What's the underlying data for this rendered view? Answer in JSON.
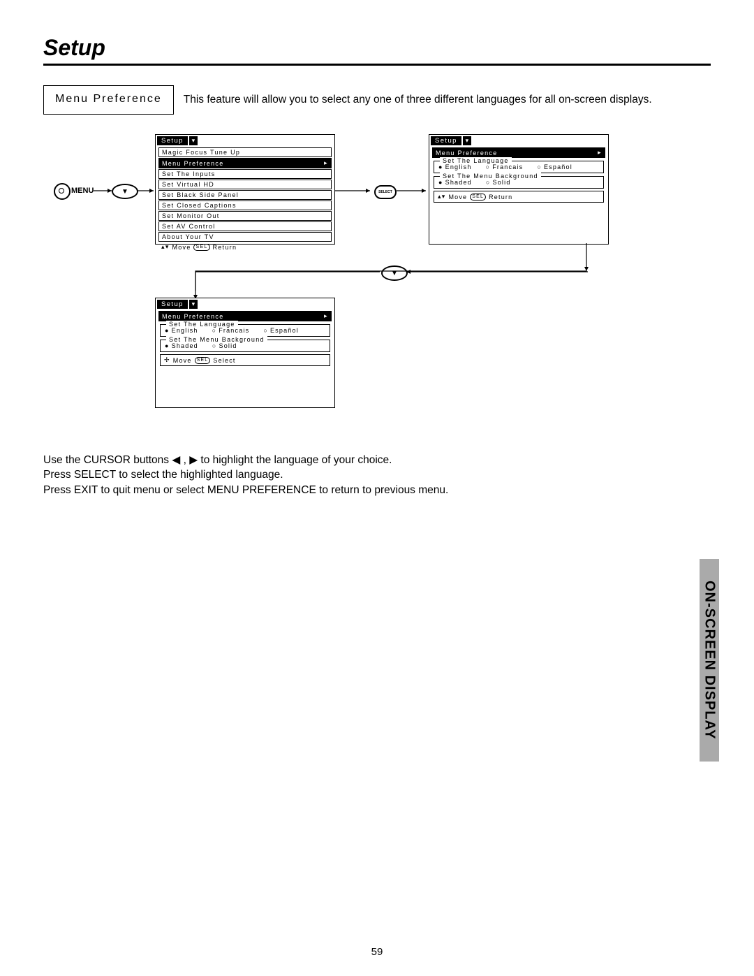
{
  "page_title": "Setup",
  "feature_name": "Menu Preference",
  "feature_desc": "This feature will allow you to select any one of three different languages for all on-screen displays.",
  "remote_label": "MENU",
  "select_btn_label": "SELECT",
  "osd1": {
    "title": "Setup",
    "items": [
      "Magic Focus Tune Up",
      "Menu Preference",
      "Set The Inputs",
      "Set Virtual HD",
      "Set Black Side Panel",
      "Set Closed Captions",
      "Set Monitor Out",
      "Set AV Control",
      "About Your TV"
    ],
    "highlight_index": 1,
    "footer_move": "Move",
    "footer_sel": "SEL",
    "footer_return": "Return"
  },
  "osd_lang": {
    "title": "Setup",
    "sub": "Menu Preference",
    "group1_title": "Set The Language",
    "lang_options": [
      {
        "label": "English",
        "dot": "●"
      },
      {
        "label": "Francais",
        "dot": "○"
      },
      {
        "label": "Español",
        "dot": "○"
      }
    ],
    "group2_title": "Set The Menu Background",
    "bg_options": [
      {
        "label": "Shaded",
        "dot": "●"
      },
      {
        "label": "Solid",
        "dot": "○"
      }
    ],
    "footer2_move": "Move",
    "footer2_sel": "SEL",
    "footer2_return": "Return",
    "footer3_move": "Move",
    "footer3_sel": "SEL",
    "footer3_select": "Select"
  },
  "instructions": [
    "Use the CURSOR buttons ◀ , ▶ to highlight the language of your choice.",
    "Press SELECT to select the highlighted language.",
    "Press EXIT to quit menu or select MENU PREFERENCE to return to previous menu."
  ],
  "side_tab": "ON-SCREEN DISPLAY",
  "page_number": "59"
}
